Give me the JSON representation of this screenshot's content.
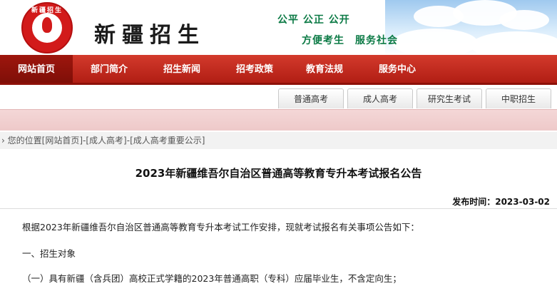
{
  "header": {
    "site_title": "新疆招生",
    "logo_text": "新疆招生",
    "slogan_line1": "公平 公正 公开",
    "slogan_line2": "方便考生　服务社会"
  },
  "main_nav": {
    "items": [
      {
        "label": "网站首页",
        "active": true
      },
      {
        "label": "部门简介",
        "active": false
      },
      {
        "label": "招生新闻",
        "active": false
      },
      {
        "label": "招考政策",
        "active": false
      },
      {
        "label": "教育法规",
        "active": false
      },
      {
        "label": "服务中心",
        "active": false
      }
    ]
  },
  "sub_tabs": {
    "items": [
      {
        "label": "普通高考"
      },
      {
        "label": "成人高考"
      },
      {
        "label": "研究生考试"
      },
      {
        "label": "中职招生"
      }
    ]
  },
  "breadcrumb": {
    "prefix": "您的位置",
    "links": [
      "[网站首页]",
      "[成人高考]",
      "[成人高考重要公示]"
    ],
    "separator": "-"
  },
  "article": {
    "title": "2023年新疆维吾尔自治区普通高等教育专升本考试报名公告",
    "publish_label": "发布时间：",
    "publish_date": "2023-03-02",
    "paragraphs": [
      "根据2023年新疆维吾尔自治区普通高等教育专升本考试工作安排，现就考试报名有关事项公告如下：",
      "一、招生对象",
      "（一）具有新疆（含兵团）高校正式学籍的2023年普通高职（专科）应届毕业生，不含定向生；"
    ]
  },
  "colors": {
    "nav_red": "#b11e14",
    "nav_active": "#7f0f08",
    "slogan_green": "#0b7a45",
    "band_pink": "#f2d2d2"
  }
}
